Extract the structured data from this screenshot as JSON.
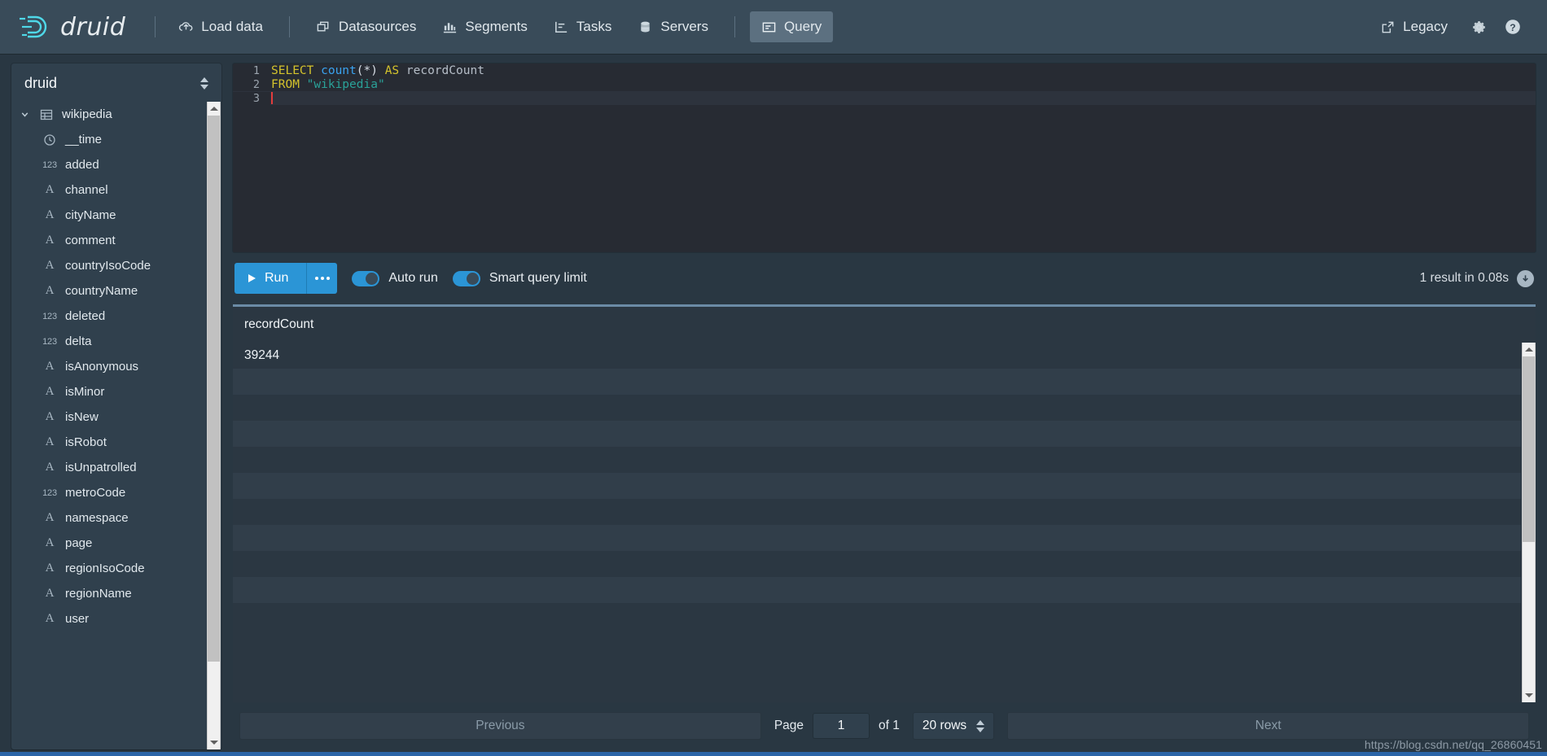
{
  "header": {
    "brand": "druid",
    "brand_icon": "druid-logo-icon",
    "nav_items": [
      {
        "label": "Load data",
        "icon": "cloud-upload-icon",
        "active": false
      },
      {
        "label": "Datasources",
        "icon": "multi-box-icon",
        "active": false
      },
      {
        "label": "Segments",
        "icon": "bar-chart-icon",
        "active": false
      },
      {
        "label": "Tasks",
        "icon": "gantt-chart-icon",
        "active": false
      },
      {
        "label": "Servers",
        "icon": "database-icon",
        "active": false
      },
      {
        "label": "Query",
        "icon": "application-icon",
        "active": true
      }
    ],
    "legacy_label": "Legacy",
    "legacy_icon": "share-external-icon",
    "settings_icon": "gear-icon",
    "help_icon": "help-circle-icon"
  },
  "sidebar": {
    "schema": "druid",
    "schema_caret_icon": "double-caret-vertical-icon",
    "datasource": {
      "name": "wikipedia",
      "icon": "table-icon",
      "caret_icon": "chevron-down-icon",
      "expanded": true
    },
    "columns": [
      {
        "name": "__time",
        "type": "time",
        "icon": "clock-icon"
      },
      {
        "name": "added",
        "type": "number",
        "icon": "numeric-icon"
      },
      {
        "name": "channel",
        "type": "string",
        "icon": "string-icon"
      },
      {
        "name": "cityName",
        "type": "string",
        "icon": "string-icon"
      },
      {
        "name": "comment",
        "type": "string",
        "icon": "string-icon"
      },
      {
        "name": "countryIsoCode",
        "type": "string",
        "icon": "string-icon"
      },
      {
        "name": "countryName",
        "type": "string",
        "icon": "string-icon"
      },
      {
        "name": "deleted",
        "type": "number",
        "icon": "numeric-icon"
      },
      {
        "name": "delta",
        "type": "number",
        "icon": "numeric-icon"
      },
      {
        "name": "isAnonymous",
        "type": "string",
        "icon": "string-icon"
      },
      {
        "name": "isMinor",
        "type": "string",
        "icon": "string-icon"
      },
      {
        "name": "isNew",
        "type": "string",
        "icon": "string-icon"
      },
      {
        "name": "isRobot",
        "type": "string",
        "icon": "string-icon"
      },
      {
        "name": "isUnpatrolled",
        "type": "string",
        "icon": "string-icon"
      },
      {
        "name": "metroCode",
        "type": "number",
        "icon": "numeric-icon"
      },
      {
        "name": "namespace",
        "type": "string",
        "icon": "string-icon"
      },
      {
        "name": "page",
        "type": "string",
        "icon": "string-icon"
      },
      {
        "name": "regionIsoCode",
        "type": "string",
        "icon": "string-icon"
      },
      {
        "name": "regionName",
        "type": "string",
        "icon": "string-icon"
      },
      {
        "name": "user",
        "type": "string",
        "icon": "string-icon"
      }
    ]
  },
  "editor": {
    "query_text": "SELECT count(*) AS recordCount\nFROM \"wikipedia\"\n",
    "lines": [
      {
        "number": "1",
        "tokens": [
          {
            "t": "SELECT ",
            "c": "k-kw"
          },
          {
            "t": "count",
            "c": "k-fn"
          },
          {
            "t": "(*) ",
            "c": "k-punc"
          },
          {
            "t": "AS ",
            "c": "k-kw"
          },
          {
            "t": "recordCount",
            "c": "k-id"
          }
        ]
      },
      {
        "number": "2",
        "tokens": [
          {
            "t": "FROM ",
            "c": "k-kw"
          },
          {
            "t": "\"wikipedia\"",
            "c": "k-str"
          }
        ]
      },
      {
        "number": "3",
        "tokens": []
      }
    ]
  },
  "toolbar": {
    "run_label": "Run",
    "run_icon": "play-icon",
    "more_icon": "more-dots-icon",
    "auto_run_label": "Auto run",
    "auto_run_on": true,
    "smart_limit_label": "Smart query limit",
    "smart_limit_on": true,
    "result_info": "1 result in 0.08s",
    "download_icon": "download-arrow-icon"
  },
  "results": {
    "columns": [
      "recordCount"
    ],
    "rows": [
      [
        "39244"
      ]
    ],
    "empty_row_count": 9
  },
  "pager": {
    "previous_label": "Previous",
    "next_label": "Next",
    "page_label": "Page",
    "page_value": "1",
    "of_label": "of 1",
    "rows_per_page": "20 rows",
    "rows_caret_icon": "double-caret-vertical-icon"
  },
  "watermark": "https://blog.csdn.net/qq_26860451",
  "colors": {
    "accent_blue": "#2b95d6",
    "navbar_bg": "#394b59",
    "panel_bg": "#30404d",
    "app_bg": "#293742",
    "editor_bg": "#272b33",
    "keyword_yellow": "#d4c32c",
    "function_blue": "#3aa3f0",
    "string_teal": "#2aa198"
  }
}
